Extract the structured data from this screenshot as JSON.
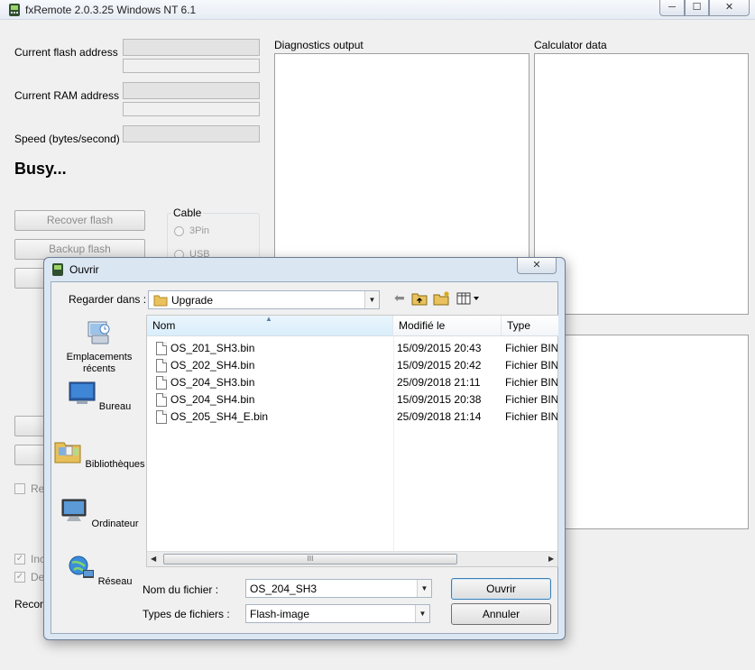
{
  "window": {
    "title": "fxRemote 2.0.3.25 Windows NT 6.1",
    "minimize_glyph": "─",
    "maximize_glyph": "☐",
    "close_glyph": "✕"
  },
  "main": {
    "labels": {
      "flash_address": "Current flash address",
      "ram_address": "Current RAM address",
      "speed": "Speed (bytes/second)"
    },
    "status": "Busy...",
    "buttons": {
      "recover_flash": "Recover flash",
      "backup_flash": "Backup flash"
    },
    "cable": {
      "label": "Cable",
      "options": [
        "3Pin",
        "USB"
      ]
    },
    "panels": {
      "diagnostics": "Diagnostics output",
      "calculator": "Calculator data"
    },
    "partial_texts": {
      "re": "Re",
      "inc": "Inc",
      "de": "De",
      "recon": "Recon"
    }
  },
  "dialog": {
    "title": "Ouvrir",
    "close_glyph": "✕",
    "look_in_label": "Regarder dans :",
    "look_in_value": "Upgrade",
    "places": [
      {
        "label": "Emplacements récents",
        "icon": "recent-places-icon"
      },
      {
        "label": "Bureau",
        "icon": "desktop-icon"
      },
      {
        "label": "Bibliothèques",
        "icon": "libraries-icon"
      },
      {
        "label": "Ordinateur",
        "icon": "computer-icon"
      },
      {
        "label": "Réseau",
        "icon": "network-icon"
      }
    ],
    "columns": {
      "name": "Nom",
      "modified": "Modifié le",
      "type": "Type"
    },
    "files": [
      {
        "name": "OS_201_SH3.bin",
        "modified": "15/09/2015 20:43",
        "type": "Fichier BIN"
      },
      {
        "name": "OS_202_SH4.bin",
        "modified": "15/09/2015 20:42",
        "type": "Fichier BIN"
      },
      {
        "name": "OS_204_SH3.bin",
        "modified": "25/09/2018 21:11",
        "type": "Fichier BIN"
      },
      {
        "name": "OS_204_SH4.bin",
        "modified": "15/09/2015 20:38",
        "type": "Fichier BIN"
      },
      {
        "name": "OS_205_SH4_E.bin",
        "modified": "25/09/2018 21:14",
        "type": "Fichier BIN"
      }
    ],
    "filename_label": "Nom du fichier :",
    "filename_value": "OS_204_SH3",
    "filetype_label": "Types de fichiers :",
    "filetype_value": "Flash-image",
    "open_button": "Ouvrir",
    "cancel_button": "Annuler",
    "scroll_grip": "III"
  }
}
